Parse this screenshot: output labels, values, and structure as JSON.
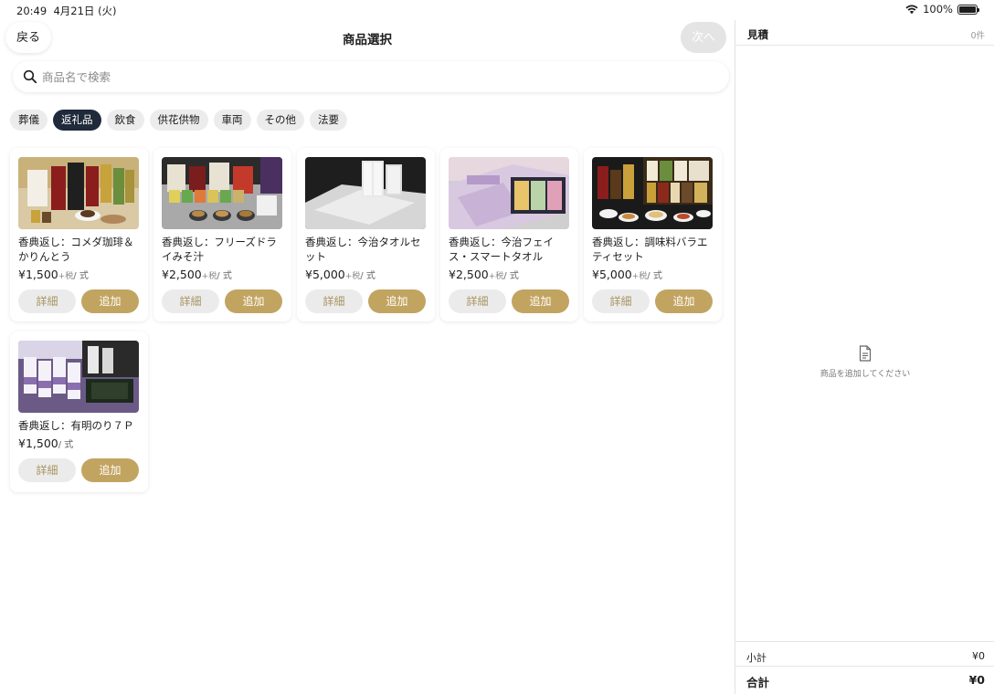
{
  "status_bar": {
    "time": "20:49",
    "date": "4月21日 (火)",
    "battery": "100%"
  },
  "nav": {
    "back_label": "戻る",
    "title": "商品選択",
    "next_label": "次へ"
  },
  "search": {
    "placeholder": "商品名で検索",
    "value": ""
  },
  "categories": [
    {
      "label": "葬儀",
      "active": false
    },
    {
      "label": "返礼品",
      "active": true
    },
    {
      "label": "飲食",
      "active": false
    },
    {
      "label": "供花供物",
      "active": false
    },
    {
      "label": "車両",
      "active": false
    },
    {
      "label": "その他",
      "active": false
    },
    {
      "label": "法要",
      "active": false
    }
  ],
  "products": [
    {
      "name": "香典返し：コメダ珈琲＆かりんとう",
      "price": "¥1,500",
      "tax": "+税",
      "unit": "/ 式",
      "image": "coffee-gift-set"
    },
    {
      "name": "香典返し：フリーズドライみそ汁",
      "price": "¥2,500",
      "tax": "+税",
      "unit": "/ 式",
      "image": "freeze-dried-miso-soup"
    },
    {
      "name": "香典返し：今治タオルセット",
      "price": "¥5,000",
      "tax": "+税",
      "unit": "/ 式",
      "image": "imabari-towel-set"
    },
    {
      "name": "香典返し：今治フェイス・スマートタオル",
      "price": "¥2,500",
      "tax": "+税",
      "unit": "/ 式",
      "image": "imabari-face-towel"
    },
    {
      "name": "香典返し：調味料バラエティセット",
      "price": "¥5,000",
      "tax": "+税",
      "unit": "/ 式",
      "image": "seasoning-variety-set"
    },
    {
      "name": "香典返し：有明のり７Ｐ",
      "price": "¥1,500",
      "tax": "",
      "unit": "/ 式",
      "image": "ariake-nori-7p"
    }
  ],
  "card_buttons": {
    "detail_label": "詳細",
    "add_label": "追加"
  },
  "quote": {
    "title": "見積",
    "count": "0件",
    "empty_message": "商品を追加してください",
    "subtotal_label": "小計",
    "subtotal_value": "¥0",
    "total_label": "合計",
    "total_value": "¥0"
  },
  "colors": {
    "accent_gold": "#c2a461",
    "chip_active": "#1f2a3a",
    "chip_inactive": "#ececec",
    "detail_button": "#ebebeb"
  }
}
